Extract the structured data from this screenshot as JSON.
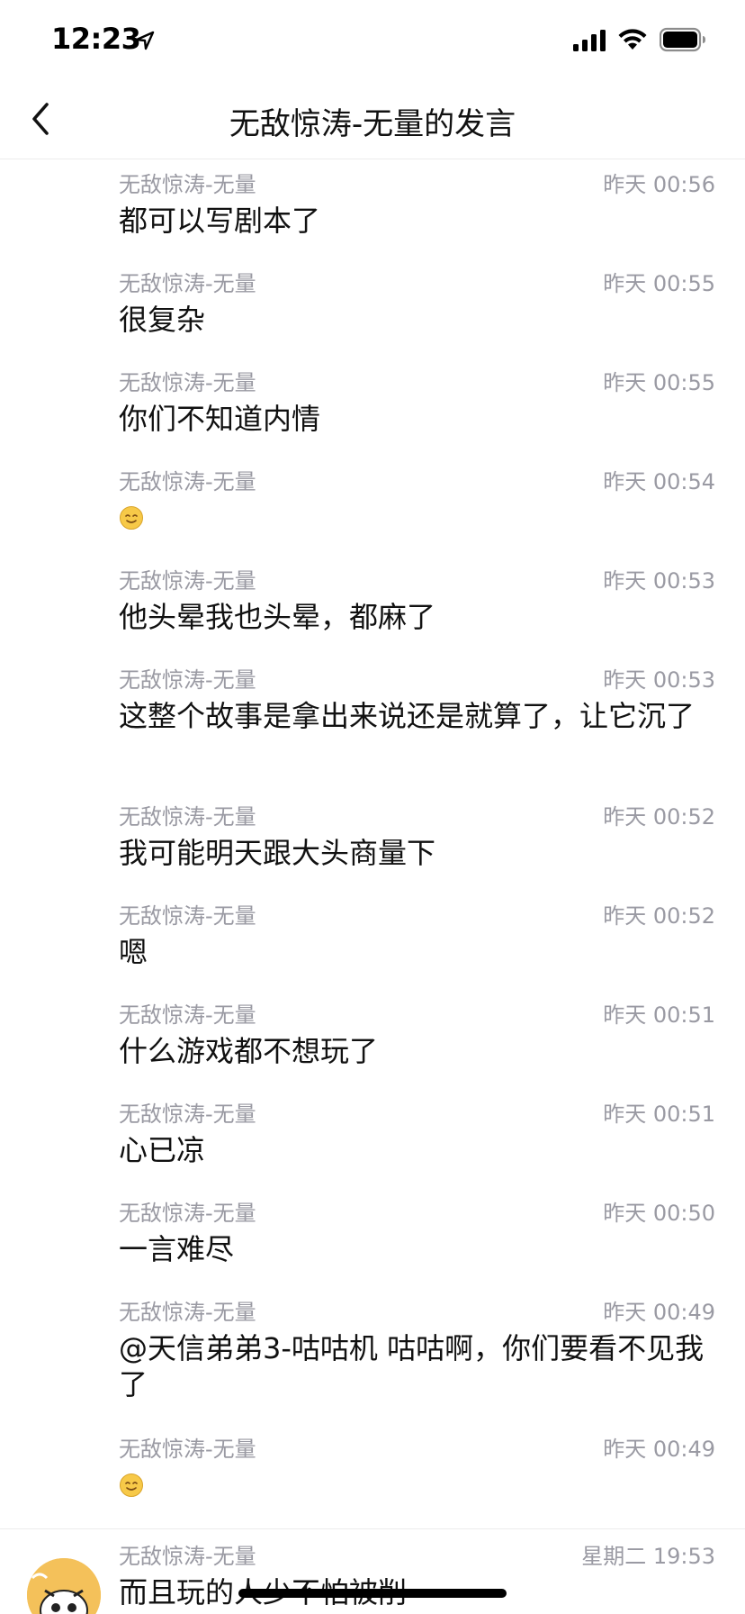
{
  "status_bar": {
    "time": "12:23"
  },
  "header": {
    "title": "无敌惊涛-无量的发言"
  },
  "messages": [
    {
      "sender": "无敌惊涛-无量",
      "time": "昨天 00:56",
      "text": "都可以写剧本了"
    },
    {
      "sender": "无敌惊涛-无量",
      "time": "昨天 00:55",
      "text": "很复杂"
    },
    {
      "sender": "无敌惊涛-无量",
      "time": "昨天 00:55",
      "text": "你们不知道内情"
    },
    {
      "sender": "无敌惊涛-无量",
      "time": "昨天 00:54",
      "text": "",
      "emoji": "smile-emoji"
    },
    {
      "sender": "无敌惊涛-无量",
      "time": "昨天 00:53",
      "text": "他头晕我也头晕，都麻了"
    },
    {
      "sender": "无敌惊涛-无量",
      "time": "昨天 00:53",
      "text": "这整个故事是拿出来说还是就算了，让它沉了"
    },
    {
      "sender": "无敌惊涛-无量",
      "time": "昨天 00:52",
      "text": "我可能明天跟大头商量下"
    },
    {
      "sender": "无敌惊涛-无量",
      "time": "昨天 00:52",
      "text": "嗯"
    },
    {
      "sender": "无敌惊涛-无量",
      "time": "昨天 00:51",
      "text": "什么游戏都不想玩了"
    },
    {
      "sender": "无敌惊涛-无量",
      "time": "昨天 00:51",
      "text": "心已凉"
    },
    {
      "sender": "无敌惊涛-无量",
      "time": "昨天 00:50",
      "text": "一言难尽"
    },
    {
      "sender": "无敌惊涛-无量",
      "time": "昨天 00:49",
      "text": "@天信弟弟3-咕咕机 咕咕啊，你们要看不见我了"
    },
    {
      "sender": "无敌惊涛-无量",
      "time": "昨天 00:49",
      "text": "",
      "emoji": "smile-emoji"
    },
    {
      "sender": "无敌惊涛-无量",
      "time": "星期二 19:53",
      "text": "而且玩的人少不怕被削"
    }
  ],
  "colors": {
    "meta_text": "#9a9aa3",
    "body_text": "#111111",
    "divider": "#ececec",
    "emoji_yellow": "#f7c948"
  }
}
